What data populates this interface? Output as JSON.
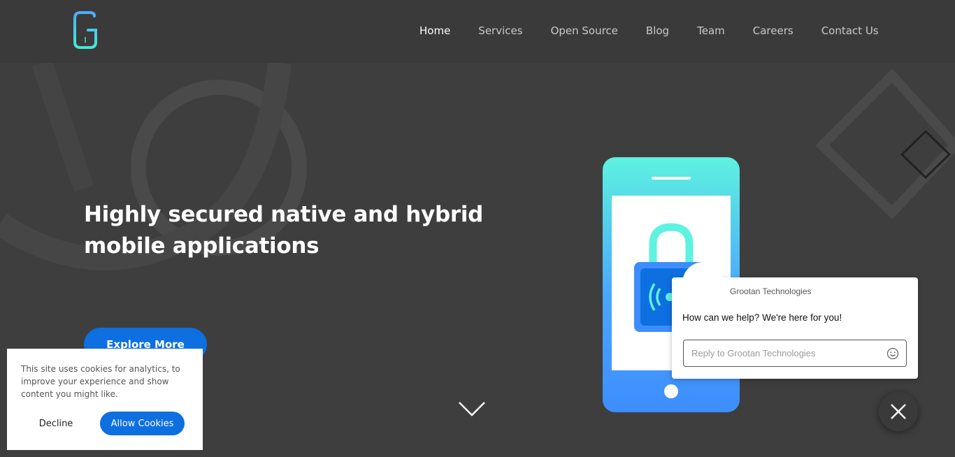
{
  "brand": {
    "logo_letter": "G",
    "logo_gradient": [
      "#4facfe",
      "#43e8d8"
    ]
  },
  "nav": {
    "items": [
      {
        "label": "Home",
        "active": true
      },
      {
        "label": "Services",
        "active": false
      },
      {
        "label": "Open Source",
        "active": false
      },
      {
        "label": "Blog",
        "active": false
      },
      {
        "label": "Team",
        "active": false
      },
      {
        "label": "Careers",
        "active": false
      },
      {
        "label": "Contact Us",
        "active": false
      }
    ]
  },
  "hero": {
    "title_line1": "Highly secured native and hybrid",
    "title_line2": "mobile applications",
    "cta_label": "Explore More"
  },
  "cookie_banner": {
    "text": "This site uses cookies for analytics, to improve your experience and show content you might like.",
    "decline_label": "Decline",
    "allow_label": "Allow Cookies"
  },
  "chat_widget": {
    "company": "Grootan Technologies",
    "message": "How can we help? We're here for you!",
    "input_placeholder": "Reply to Grootan Technologies"
  },
  "colors": {
    "background": "#3b3b3b",
    "accent_blue": "#0e6fe0",
    "phone_gradient_top": "#5ef2e0",
    "phone_gradient_bottom": "#3d8dfc"
  },
  "icons": [
    "logo-icon",
    "scroll-down-chevron-icon",
    "phone-lock-illustration",
    "diamond-outline-icon",
    "emoji-icon",
    "close-icon"
  ]
}
